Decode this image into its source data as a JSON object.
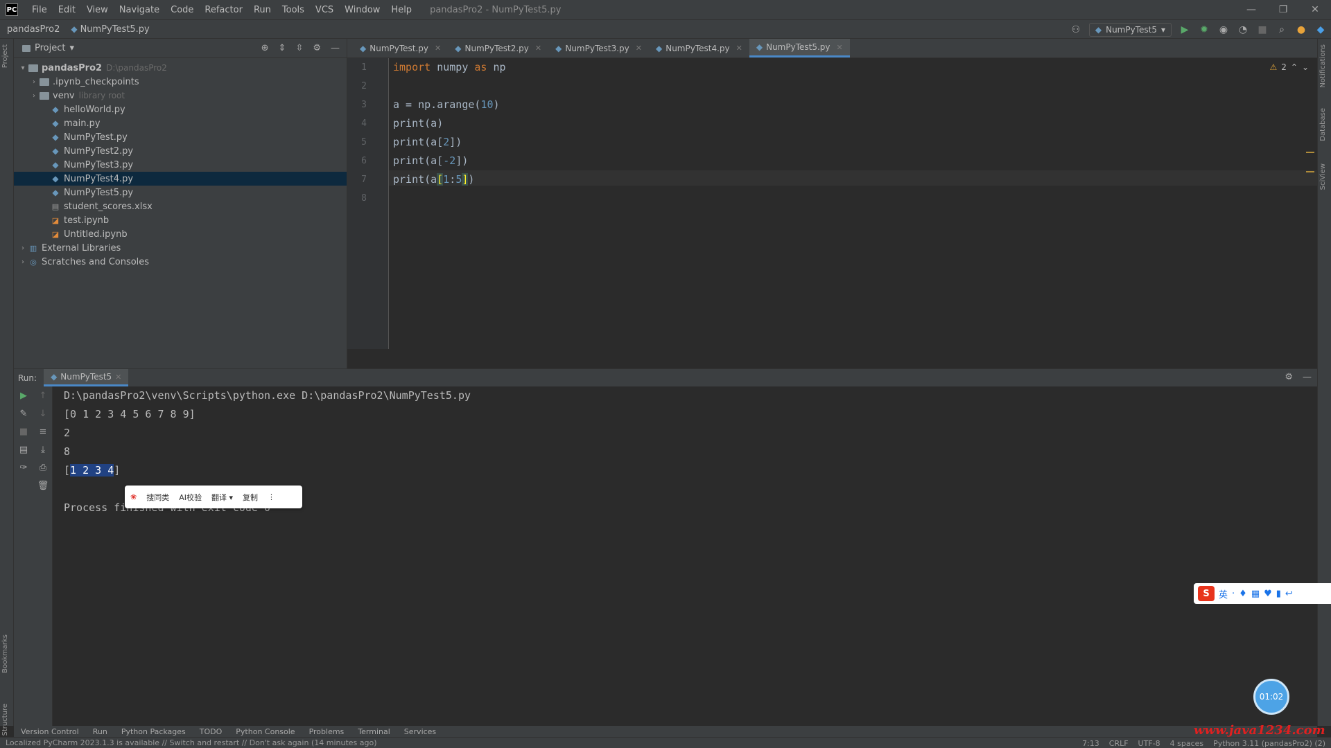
{
  "window": {
    "title": "pandasPro2 - NumPyTest5.py",
    "menu": [
      "File",
      "Edit",
      "View",
      "Navigate",
      "Code",
      "Refactor",
      "Run",
      "Tools",
      "VCS",
      "Window",
      "Help"
    ],
    "controls": [
      "—",
      "❐",
      "✕"
    ]
  },
  "navbar": {
    "project": "pandasPro2",
    "file": "NumPyTest5.py",
    "run_config": "NumPyTest5"
  },
  "project_panel": {
    "title": "Project",
    "tree": [
      {
        "label": "pandasPro2",
        "hint": "D:\\pandasPro2",
        "depth": 0,
        "kind": "folder",
        "arrow": "▾"
      },
      {
        "label": ".ipynb_checkpoints",
        "hint": "",
        "depth": 1,
        "kind": "folder",
        "arrow": "›"
      },
      {
        "label": "venv",
        "hint": "library root",
        "depth": 1,
        "kind": "folder",
        "arrow": "›"
      },
      {
        "label": "helloWorld.py",
        "hint": "",
        "depth": 2,
        "kind": "py",
        "arrow": ""
      },
      {
        "label": "main.py",
        "hint": "",
        "depth": 2,
        "kind": "py",
        "arrow": ""
      },
      {
        "label": "NumPyTest.py",
        "hint": "",
        "depth": 2,
        "kind": "py",
        "arrow": ""
      },
      {
        "label": "NumPyTest2.py",
        "hint": "",
        "depth": 2,
        "kind": "py",
        "arrow": ""
      },
      {
        "label": "NumPyTest3.py",
        "hint": "",
        "depth": 2,
        "kind": "py",
        "arrow": ""
      },
      {
        "label": "NumPyTest4.py",
        "hint": "",
        "depth": 2,
        "kind": "py",
        "arrow": "",
        "selected": true
      },
      {
        "label": "NumPyTest5.py",
        "hint": "",
        "depth": 2,
        "kind": "py",
        "arrow": ""
      },
      {
        "label": "student_scores.xlsx",
        "hint": "",
        "depth": 2,
        "kind": "file",
        "arrow": ""
      },
      {
        "label": "test.ipynb",
        "hint": "",
        "depth": 2,
        "kind": "nb",
        "arrow": ""
      },
      {
        "label": "Untitled.ipynb",
        "hint": "",
        "depth": 2,
        "kind": "nb",
        "arrow": ""
      },
      {
        "label": "External Libraries",
        "hint": "",
        "depth": 0,
        "kind": "lib",
        "arrow": "›"
      },
      {
        "label": "Scratches and Consoles",
        "hint": "",
        "depth": 0,
        "kind": "scratch",
        "arrow": "›"
      }
    ]
  },
  "editor_tabs": [
    {
      "label": "NumPyTest.py",
      "active": false
    },
    {
      "label": "NumPyTest2.py",
      "active": false
    },
    {
      "label": "NumPyTest3.py",
      "active": false
    },
    {
      "label": "NumPyTest4.py",
      "active": false
    },
    {
      "label": "NumPyTest5.py",
      "active": true
    }
  ],
  "editor": {
    "inspection_count": "2",
    "lines": [
      {
        "n": "1",
        "html": "<span class=\"kw\">import</span> numpy <span class=\"kw\">as</span> np"
      },
      {
        "n": "2",
        "html": ""
      },
      {
        "n": "3",
        "html": "a = np.arange(<span class=\"num\">10</span>)"
      },
      {
        "n": "4",
        "html": "print(a)"
      },
      {
        "n": "5",
        "html": "print(a[<span class=\"num\">2</span>])"
      },
      {
        "n": "6",
        "html": "print(a[<span class=\"num\">-2</span>])"
      },
      {
        "n": "7",
        "html": "print(a<span class=\"brk\">[</span><span class=\"num\">1</span>:<span class=\"num\">5</span><span class=\"brk\">]</span>)"
      },
      {
        "n": "8",
        "html": ""
      }
    ]
  },
  "run_window": {
    "label": "Run:",
    "tab": "NumPyTest5",
    "output": [
      "D:\\pandasPro2\\venv\\Scripts\\python.exe D:\\pandasPro2\\NumPyTest5.py",
      "[0 1 2 3 4 5 6 7 8 9]",
      "2",
      "8",
      "",
      "",
      "Process finished with exit code 0"
    ],
    "selected_output_prefix": "[",
    "selected_output_text": "1 2 3 4",
    "selected_output_suffix": "]"
  },
  "selection_popup": {
    "items": [
      "搜同类",
      "AI校验",
      "翻译 ▾",
      "复制",
      "⋮"
    ]
  },
  "tool_buttons": [
    "Version Control",
    "Run",
    "Python Packages",
    "TODO",
    "Python Console",
    "Problems",
    "Terminal",
    "Services"
  ],
  "status_bar": {
    "message": "Localized PyCharm 2023.1.3 is available // Switch and restart // Don't ask again (14 minutes ago)",
    "right": [
      "7:13",
      "CRLF",
      "UTF-8",
      "4 spaces",
      "Python 3.11 (pandasPro2) (2)"
    ]
  },
  "overlays": {
    "ime_bar": [
      "S",
      "英",
      "·",
      "♦",
      "▦",
      "♥",
      "▮",
      "↩"
    ],
    "timer": "01:02",
    "watermark": "www.java1234.com"
  }
}
